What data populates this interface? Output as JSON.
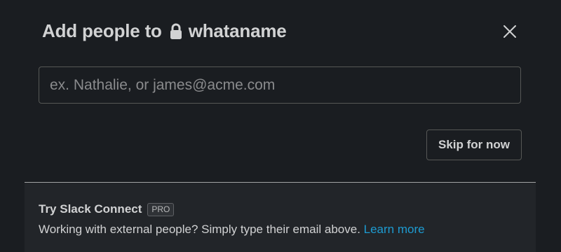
{
  "modal": {
    "title_prefix": "Add people to",
    "title_lock_icon": "lock-icon",
    "channel_name": "whataname",
    "close_icon": "close-icon"
  },
  "invite": {
    "placeholder": "ex. Nathalie, or james@acme.com",
    "value": ""
  },
  "actions": {
    "skip_label": "Skip for now"
  },
  "footer": {
    "title": "Try Slack Connect",
    "badge": "PRO",
    "description": "Working with external people? Simply type their email above.",
    "link_label": "Learn more"
  },
  "colors": {
    "background": "#1a1d21",
    "footer_background": "#222529",
    "text": "#d1d2d3",
    "link": "#1d9bd1",
    "border": "#565856"
  }
}
